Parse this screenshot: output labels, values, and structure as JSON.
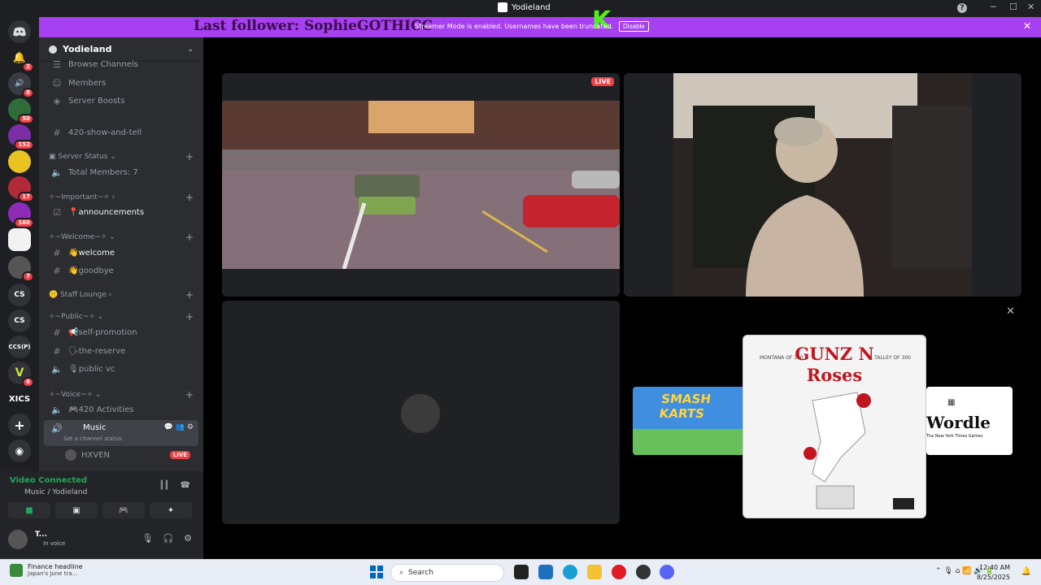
{
  "window": {
    "title": "Yodieland"
  },
  "banner": {
    "follower_text": "Last follower: SophieGOTHICC",
    "notice": "Streamer Mode is enabled. Usernames have been truncated.",
    "disable_label": "Disable",
    "close": "✕"
  },
  "rail": {
    "badges": [
      "2",
      "8",
      "50",
      "152",
      "17",
      "160",
      "7",
      "6"
    ],
    "text_servers": [
      "CS",
      "CS",
      "CCS(P)",
      "XICS"
    ]
  },
  "sidebar": {
    "server_name": "Yodieland",
    "browse": "Browse Channels",
    "members": "Members",
    "boosts": "Server Boosts",
    "ch_420": "420-show-and-tell",
    "cat_status": "Server Status",
    "total_members": "Total Members: 7",
    "cat_important": "✧~Important~✧",
    "announcements": "announcements",
    "cat_welcome": "✧~Welcome~✧",
    "welcome": "welcome",
    "goodbye": "goodbye",
    "cat_staff": "Staff Lounge",
    "cat_public": "✧~Public~✧",
    "selfpromo": "self-promotion",
    "reserve": "the-reserve",
    "publicvc": "public vc",
    "cat_voice": "✧~Voice~✧",
    "activities": "420 Activities",
    "music": "Music",
    "music_status": "Set a channel status",
    "member_hxven": "HXVEN",
    "live_label": "LIVE"
  },
  "voice": {
    "connected": "Video Connected",
    "location": "Music / Yodieland",
    "username": "T...",
    "status": "In voice"
  },
  "stage": {
    "live_label": "LIVE",
    "close": "✕",
    "activities": [
      "SMASH KARTS",
      "GUNZ N Roses",
      "Wordle"
    ],
    "album_left": "MONTANA OF 300",
    "album_right": "TALLEY OF 300",
    "wordle_sub": "The New York Times Games"
  },
  "taskbar": {
    "news_title": "Finance headline",
    "news_sub": "Japan's June tra...",
    "search": "Search",
    "time": "12:40 AM",
    "date": "8/25/2025"
  },
  "colors": {
    "banner": "#a740f0",
    "follower_text": "#3a0b4a",
    "live": "#f23f43",
    "connected": "#23a55a",
    "sidebar": "#2b2d31",
    "rail": "#1e1f22"
  }
}
